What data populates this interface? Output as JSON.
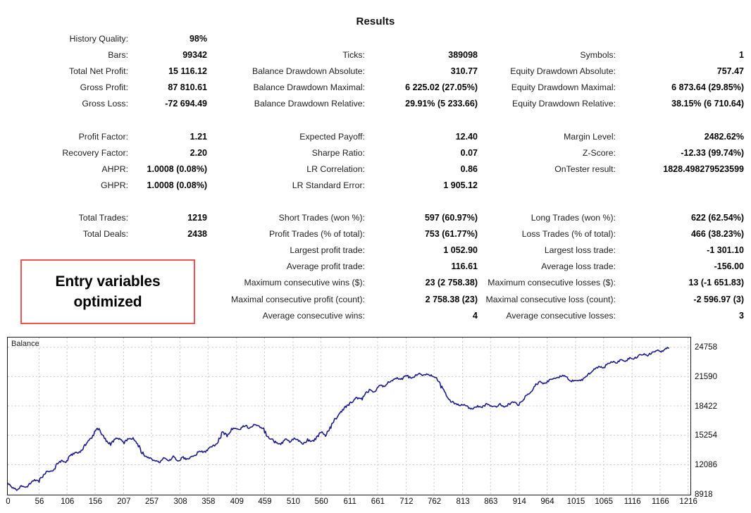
{
  "header": {
    "title": "Results"
  },
  "annotation": {
    "line1": "Entry variables",
    "line2": "optimized",
    "border_color": "#f4544f"
  },
  "stats": {
    "column1": [
      {
        "label": "History Quality:",
        "value": "98%"
      },
      {
        "label": "Bars:",
        "value": "99342"
      },
      {
        "label": "Total Net Profit:",
        "value": "15 116.12"
      },
      {
        "label": "Gross Profit:",
        "value": "87 810.61"
      },
      {
        "label": "Gross Loss:",
        "value": "-72 694.49"
      },
      {
        "label": "",
        "value": ""
      },
      {
        "label": "Profit Factor:",
        "value": "1.21"
      },
      {
        "label": "Recovery Factor:",
        "value": "2.20"
      },
      {
        "label": "AHPR:",
        "value": "1.0008 (0.08%)"
      },
      {
        "label": "GHPR:",
        "value": "1.0008 (0.08%)"
      },
      {
        "label": "",
        "value": ""
      },
      {
        "label": "Total Trades:",
        "value": "1219"
      },
      {
        "label": "Total Deals:",
        "value": "2438"
      }
    ],
    "column2": [
      {
        "label": "",
        "value": ""
      },
      {
        "label": "Ticks:",
        "value": "389098"
      },
      {
        "label": "Balance Drawdown Absolute:",
        "value": "310.77"
      },
      {
        "label": "Balance Drawdown Maximal:",
        "value": "6 225.02 (27.05%)"
      },
      {
        "label": "Balance Drawdown Relative:",
        "value": "29.91% (5 233.66)"
      },
      {
        "label": "",
        "value": ""
      },
      {
        "label": "Expected Payoff:",
        "value": "12.40"
      },
      {
        "label": "Sharpe Ratio:",
        "value": "0.07"
      },
      {
        "label": "LR Correlation:",
        "value": "0.86"
      },
      {
        "label": "LR Standard Error:",
        "value": "1 905.12"
      },
      {
        "label": "",
        "value": ""
      },
      {
        "label": "Short Trades (won %):",
        "value": "597 (60.97%)"
      },
      {
        "label": "Profit Trades (% of total):",
        "value": "753 (61.77%)"
      },
      {
        "label": "Largest profit trade:",
        "value": "1 052.90"
      },
      {
        "label": "Average profit trade:",
        "value": "116.61"
      },
      {
        "label": "Maximum consecutive wins ($):",
        "value": "23 (2 758.38)"
      },
      {
        "label": "Maximal consecutive profit (count):",
        "value": "2 758.38 (23)"
      },
      {
        "label": "Average consecutive wins:",
        "value": "4"
      }
    ],
    "column3": [
      {
        "label": "",
        "value": ""
      },
      {
        "label": "Symbols:",
        "value": "1"
      },
      {
        "label": "Equity Drawdown Absolute:",
        "value": "757.47"
      },
      {
        "label": "Equity Drawdown Maximal:",
        "value": "6 873.64 (29.85%)"
      },
      {
        "label": "Equity Drawdown Relative:",
        "value": "38.15% (6 710.64)"
      },
      {
        "label": "",
        "value": ""
      },
      {
        "label": "Margin Level:",
        "value": "2482.62%"
      },
      {
        "label": "Z-Score:",
        "value": "-12.33 (99.74%)"
      },
      {
        "label": "OnTester result:",
        "value": "1828.498279523599"
      },
      {
        "label": "",
        "value": ""
      },
      {
        "label": "",
        "value": ""
      },
      {
        "label": "Long Trades (won %):",
        "value": "622 (62.54%)"
      },
      {
        "label": "Loss Trades (% of total):",
        "value": "466 (38.23%)"
      },
      {
        "label": "Largest loss trade:",
        "value": "-1 301.10"
      },
      {
        "label": "Average loss trade:",
        "value": "-156.00"
      },
      {
        "label": "Maximum consecutive losses ($):",
        "value": "13 (-1 651.83)"
      },
      {
        "label": "Maximal consecutive loss (count):",
        "value": "-2 596.97 (3)"
      },
      {
        "label": "Average consecutive losses:",
        "value": "3"
      }
    ]
  },
  "chart_data": {
    "type": "line",
    "title": "",
    "legend": [
      "Balance"
    ],
    "legend_position": "top-left",
    "line_color": "#1c1c8c",
    "grid": true,
    "xlabel": "",
    "ylabel": "",
    "x_ticks": [
      0,
      56,
      106,
      156,
      207,
      257,
      308,
      358,
      409,
      459,
      510,
      560,
      611,
      661,
      712,
      762,
      813,
      863,
      914,
      964,
      1015,
      1065,
      1116,
      1166,
      1216
    ],
    "y_ticks": [
      8918,
      12086,
      15254,
      18422,
      21590,
      24758
    ],
    "xlim": [
      0,
      1219
    ],
    "ylim": [
      8918,
      25800
    ],
    "series": [
      {
        "name": "Balance",
        "x": [
          0,
          8,
          16,
          24,
          32,
          40,
          48,
          56,
          64,
          72,
          80,
          88,
          96,
          104,
          112,
          120,
          128,
          136,
          144,
          152,
          160,
          168,
          176,
          184,
          192,
          200,
          208,
          216,
          224,
          232,
          240,
          248,
          256,
          264,
          272,
          280,
          288,
          296,
          304,
          312,
          320,
          328,
          336,
          344,
          352,
          360,
          368,
          376,
          384,
          392,
          400,
          408,
          416,
          424,
          432,
          440,
          448,
          456,
          464,
          472,
          480,
          488,
          496,
          504,
          512,
          520,
          528,
          536,
          544,
          552,
          560,
          568,
          576,
          584,
          592,
          600,
          608,
          616,
          624,
          632,
          640,
          648,
          656,
          664,
          672,
          680,
          688,
          696,
          704,
          712,
          720,
          728,
          736,
          744,
          752,
          760,
          768,
          776,
          784,
          792,
          800,
          808,
          816,
          824,
          832,
          840,
          848,
          856,
          864,
          872,
          880,
          888,
          896,
          904,
          912,
          920,
          928,
          936,
          944,
          952,
          960,
          968,
          976,
          984,
          992,
          1000,
          1008,
          1016,
          1024,
          1032,
          1040,
          1048,
          1056,
          1064,
          1072,
          1080,
          1088,
          1096,
          1104,
          1112,
          1120,
          1128,
          1136,
          1144,
          1152,
          1160,
          1168,
          1176,
          1184,
          1192,
          1200,
          1208,
          1216
        ],
        "values": [
          10000,
          9650,
          9420,
          9750,
          9550,
          10050,
          10400,
          10300,
          11050,
          11400,
          11300,
          12100,
          12500,
          12400,
          13000,
          13400,
          13300,
          14000,
          14600,
          15100,
          16100,
          15500,
          14700,
          14300,
          14900,
          14800,
          14400,
          14900,
          14850,
          14300,
          13400,
          12900,
          12750,
          12450,
          12350,
          12800,
          12550,
          12900,
          12400,
          12900,
          12650,
          13000,
          13150,
          13600,
          13400,
          13900,
          14100,
          14450,
          15600,
          15200,
          15900,
          16050,
          15900,
          16350,
          16000,
          16450,
          16200,
          16000,
          15200,
          14800,
          14400,
          14250,
          14800,
          14500,
          15000,
          14700,
          14300,
          14800,
          14500,
          15000,
          15600,
          15100,
          16000,
          16900,
          17500,
          18100,
          18500,
          18900,
          19300,
          19100,
          19800,
          20200,
          19900,
          20700,
          20500,
          21000,
          21200,
          21400,
          21300,
          21750,
          21400,
          21650,
          21900,
          21700,
          21850,
          21600,
          21400,
          20400,
          19500,
          18900,
          18700,
          18400,
          18600,
          18200,
          18100,
          18400,
          18250,
          18600,
          18400,
          18300,
          18600,
          18300,
          18600,
          18900,
          18500,
          19000,
          19600,
          20100,
          20700,
          21000,
          20800,
          21200,
          21350,
          21500,
          21700,
          21500,
          21100,
          21250,
          21100,
          21500,
          21900,
          22300,
          22700,
          22500,
          22900,
          23200,
          23100,
          23400,
          23300,
          23600,
          23500,
          23900,
          24000,
          23900,
          24200,
          24400,
          24300,
          24600,
          24758
        ]
      }
    ]
  }
}
